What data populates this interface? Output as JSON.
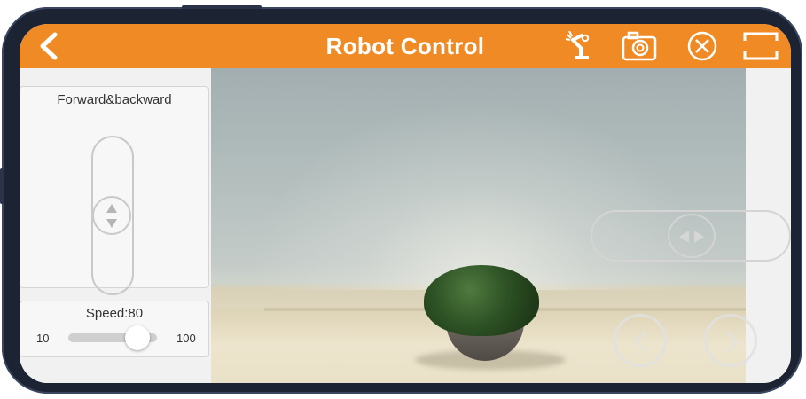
{
  "header": {
    "title": "Robot Control",
    "icons": [
      "back-arrow-icon",
      "robot-arm-icon",
      "camera-icon",
      "close-circle-icon",
      "fullscreen-icon"
    ]
  },
  "left_panel": {
    "vertical_control": {
      "label": "Forward&backward",
      "icons": [
        "up-triangle-icon",
        "down-triangle-icon"
      ]
    },
    "speed": {
      "label": "Speed:80",
      "min_label": "10",
      "max_label": "100",
      "value": 80,
      "min": 10,
      "max": 100
    }
  },
  "overlay_controls": {
    "horizontal_joystick_icons": [
      "left-triangle-icon",
      "right-triangle-icon"
    ],
    "rotate_buttons": [
      "chevron-left-icon",
      "chevron-right-icon"
    ]
  },
  "colors": {
    "accent": "#f08a24",
    "panel_bg": "#f1f1f1",
    "control_stroke": "#c9c9c9"
  }
}
